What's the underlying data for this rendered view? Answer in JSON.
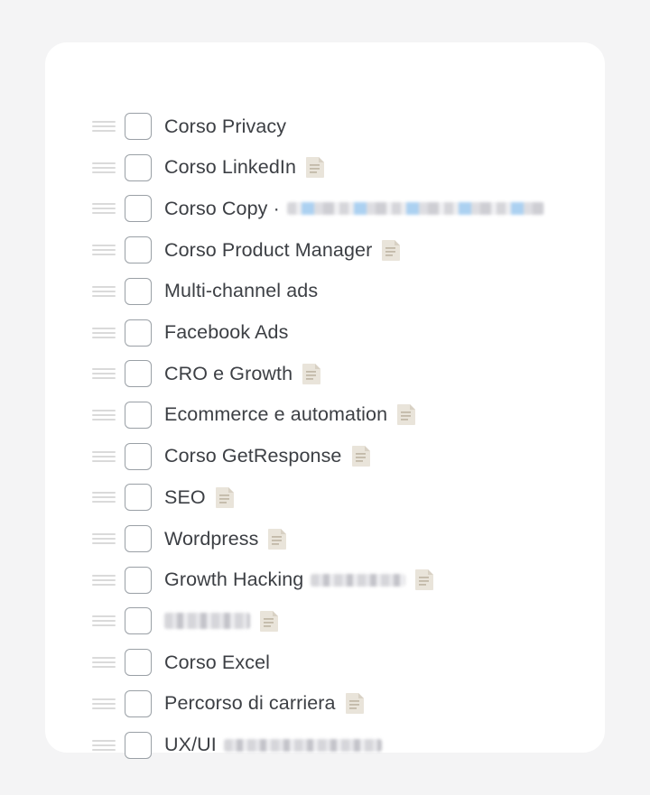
{
  "list": {
    "items": [
      {
        "label": "Corso Privacy",
        "note": false
      },
      {
        "label": "Corso LinkedIn",
        "note": true
      },
      {
        "label": "Corso Copy ·",
        "note": false,
        "obscured": "redacted-long"
      },
      {
        "label": "Corso Product Manager",
        "note": true
      },
      {
        "label": "Multi-channel ads",
        "note": false
      },
      {
        "label": "Facebook Ads",
        "note": false
      },
      {
        "label": "CRO e Growth",
        "note": true
      },
      {
        "label": "Ecommerce e automation",
        "note": true
      },
      {
        "label": "Corso GetResponse",
        "note": true
      },
      {
        "label": "SEO",
        "note": true
      },
      {
        "label": "Wordpress",
        "note": true
      },
      {
        "label": "Growth Hacking",
        "note": true,
        "obscured": "redacted-short"
      },
      {
        "label": "",
        "note": true,
        "obscured": "redacted-only"
      },
      {
        "label": "Corso Excel",
        "note": false
      },
      {
        "label": "Percorso di carriera",
        "note": true
      },
      {
        "label": "UX/UI",
        "note": false,
        "obscured": "redacted-long"
      }
    ]
  },
  "icons": {
    "drag": "drag-handle-icon",
    "note": "note-page-icon"
  },
  "colors": {
    "background": "#f4f4f5",
    "card": "#ffffff",
    "text": "#3c3f44",
    "checkbox_border": "#9aa0a6",
    "handle": "#dadada",
    "note_icon": "#e6e1d8"
  }
}
